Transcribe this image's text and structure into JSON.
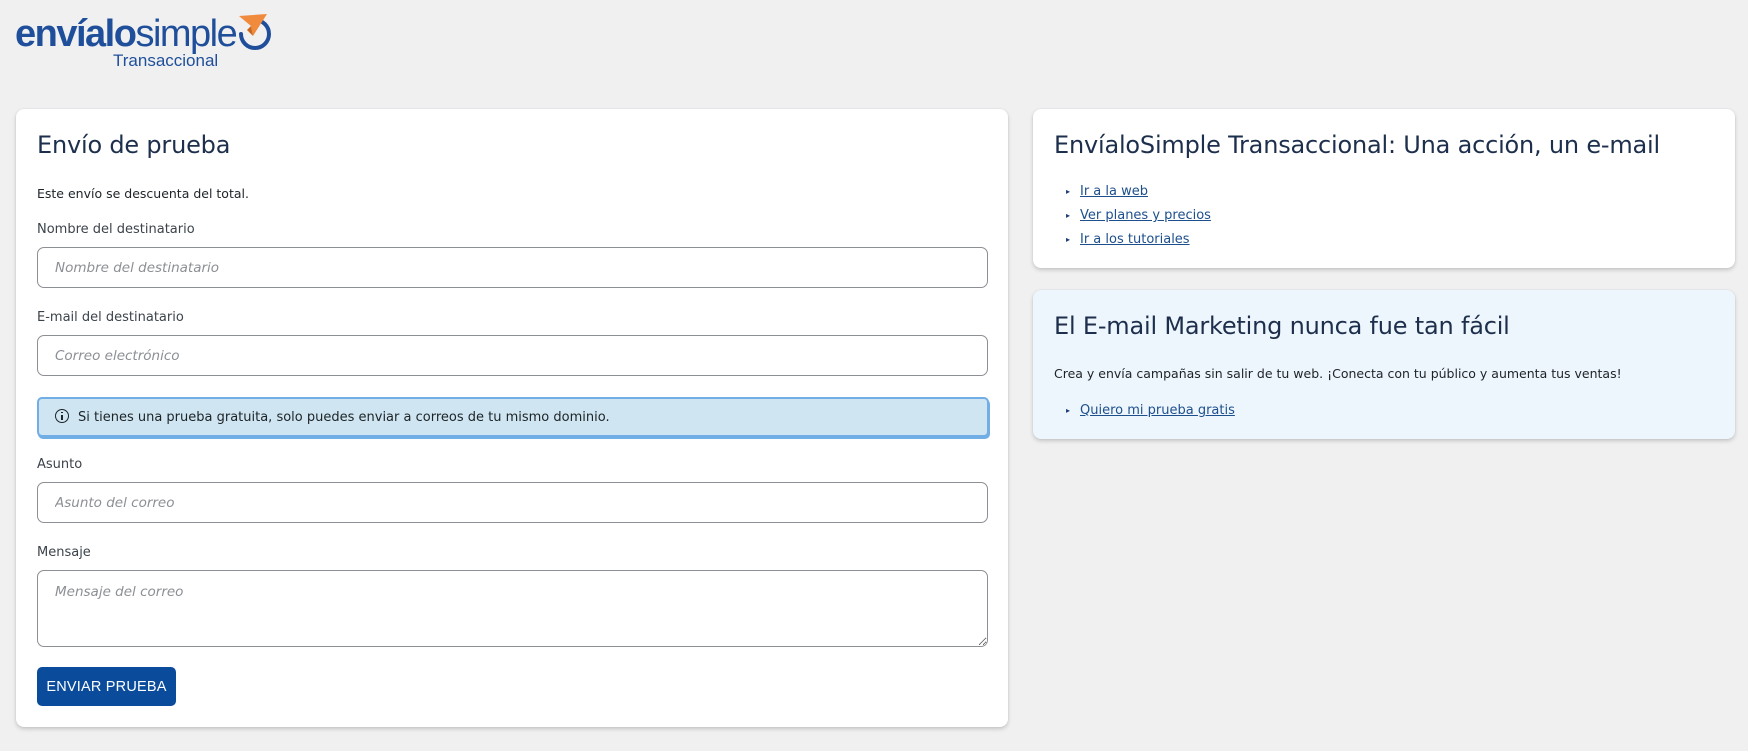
{
  "brand": {
    "logo_text_regular": "envíalo",
    "logo_text_light": "simple",
    "logo_subtitle": "Transaccional",
    "logo_color": "#1f4f9a",
    "logo_accent_color": "#f08a3c"
  },
  "form": {
    "title": "Envío de prueba",
    "intro": "Este envío se descuenta del total.",
    "recipient_name_label": "Nombre del destinatario",
    "recipient_name_placeholder": "Nombre del destinatario",
    "recipient_name_value": "",
    "recipient_email_label": "E-mail del destinatario",
    "recipient_email_placeholder": "Correo electrónico",
    "recipient_email_value": "",
    "notice_text": "Si tienes una prueba gratuita, solo puedes enviar a correos de tu mismo dominio.",
    "subject_label": "Asunto",
    "subject_placeholder": "Asunto del correo",
    "subject_value": "",
    "message_label": "Mensaje",
    "message_placeholder": "Mensaje del correo",
    "message_value": "",
    "submit_label": "ENVIAR PRUEBA",
    "submit_color": "#0a4b9b"
  },
  "info": {
    "title": "EnvíaloSimple Transaccional: Una acción, un e-mail",
    "links": [
      {
        "label": "Ir a la web"
      },
      {
        "label": "Ver planes y precios"
      },
      {
        "label": "Ir a los tutoriales"
      }
    ]
  },
  "promo": {
    "title": "El E-mail Marketing nunca fue tan fácil",
    "description": "Crea y envía campañas sin salir de tu web. ¡Conecta con tu público y aumenta tus ventas!",
    "links": [
      {
        "label": "Quiero mi prueba gratis"
      }
    ]
  }
}
